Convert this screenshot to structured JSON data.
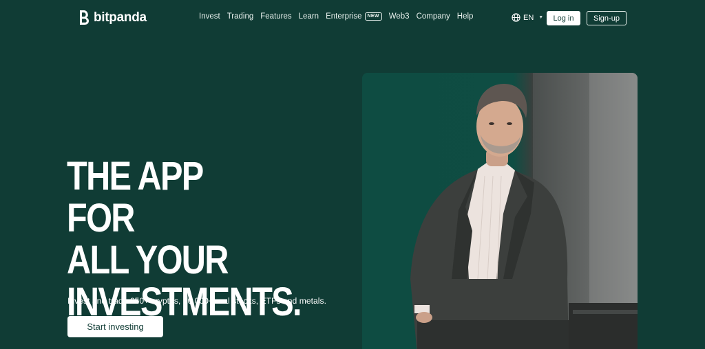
{
  "brand": {
    "name": "bitpanda",
    "logo_icon": "bitpanda-b-logo-icon"
  },
  "nav": {
    "items": [
      {
        "label": "Invest"
      },
      {
        "label": "Trading"
      },
      {
        "label": "Features"
      },
      {
        "label": "Learn"
      },
      {
        "label": "Enterprise",
        "badge": "NEW"
      },
      {
        "label": "Web3"
      },
      {
        "label": "Company"
      },
      {
        "label": "Help"
      }
    ],
    "language": {
      "icon": "globe-icon",
      "value": "EN",
      "chevron": "chevron-down-icon"
    },
    "login_label": "Log in",
    "signup_label": "Sign-up"
  },
  "hero": {
    "headline_lines": [
      "THE APP FOR",
      "ALL YOUR",
      "INVESTMENTS."
    ],
    "subtitle": "Invest and trade 650+ cryptos, 10,000+ real stocks, ETFs and metals.",
    "cta_label": "Start investing"
  },
  "colors": {
    "background": "#103c35",
    "text": "#ffffff",
    "button_bg": "#ffffff",
    "button_text": "#103c35"
  }
}
